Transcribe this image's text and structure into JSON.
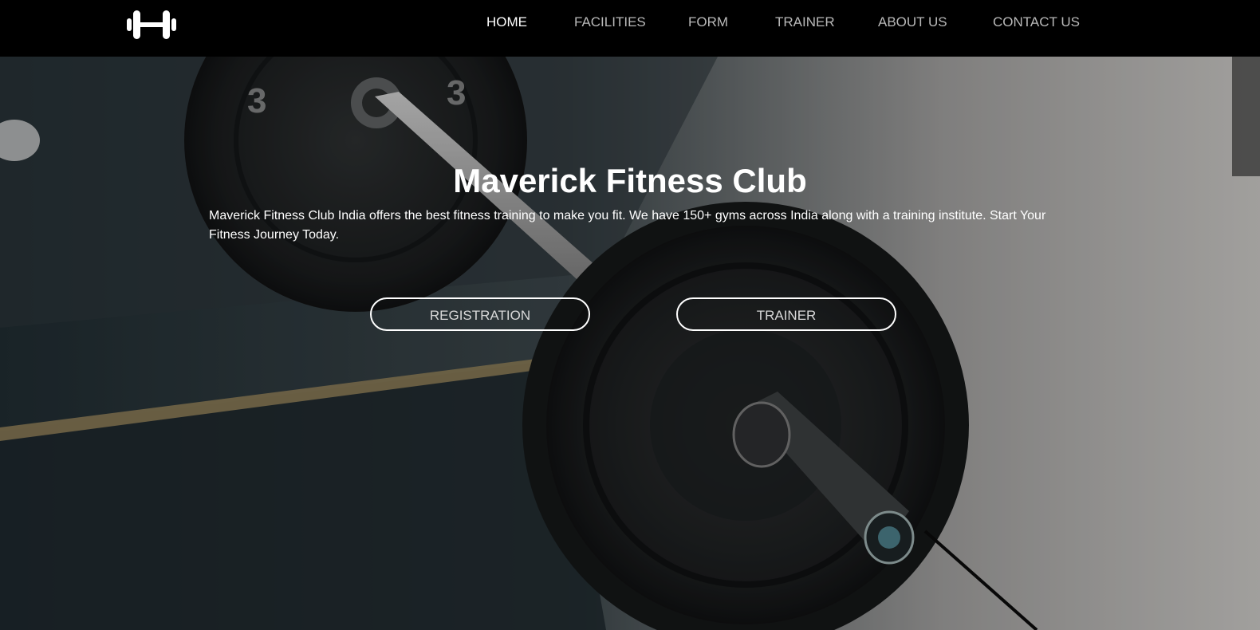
{
  "nav": {
    "logo_icon": "dumbbell-logo-icon",
    "items": [
      {
        "label": "HOME",
        "active": true
      },
      {
        "label": "FACILITIES",
        "active": false
      },
      {
        "label": "FORM",
        "active": false
      },
      {
        "label": "TRAINER",
        "active": false
      },
      {
        "label": "ABOUT US",
        "active": false
      },
      {
        "label": "CONTACT US",
        "active": false
      }
    ]
  },
  "hero": {
    "title": "Maverick Fitness Club",
    "description": "Maverick Fitness Club India offers the best fitness training to make you fit. We have 150+ gyms across India along with a training institute. Start Your Fitness Journey Today.",
    "buttons": {
      "registration": "REGISTRATION",
      "trainer": "TRAINER"
    },
    "background_image": "barbell-on-gym-floor"
  },
  "colors": {
    "navbar_bg": "#000000",
    "nav_active": "#ffffff",
    "nav_inactive": "#b9b9b9",
    "hero_text": "#ffffff"
  }
}
